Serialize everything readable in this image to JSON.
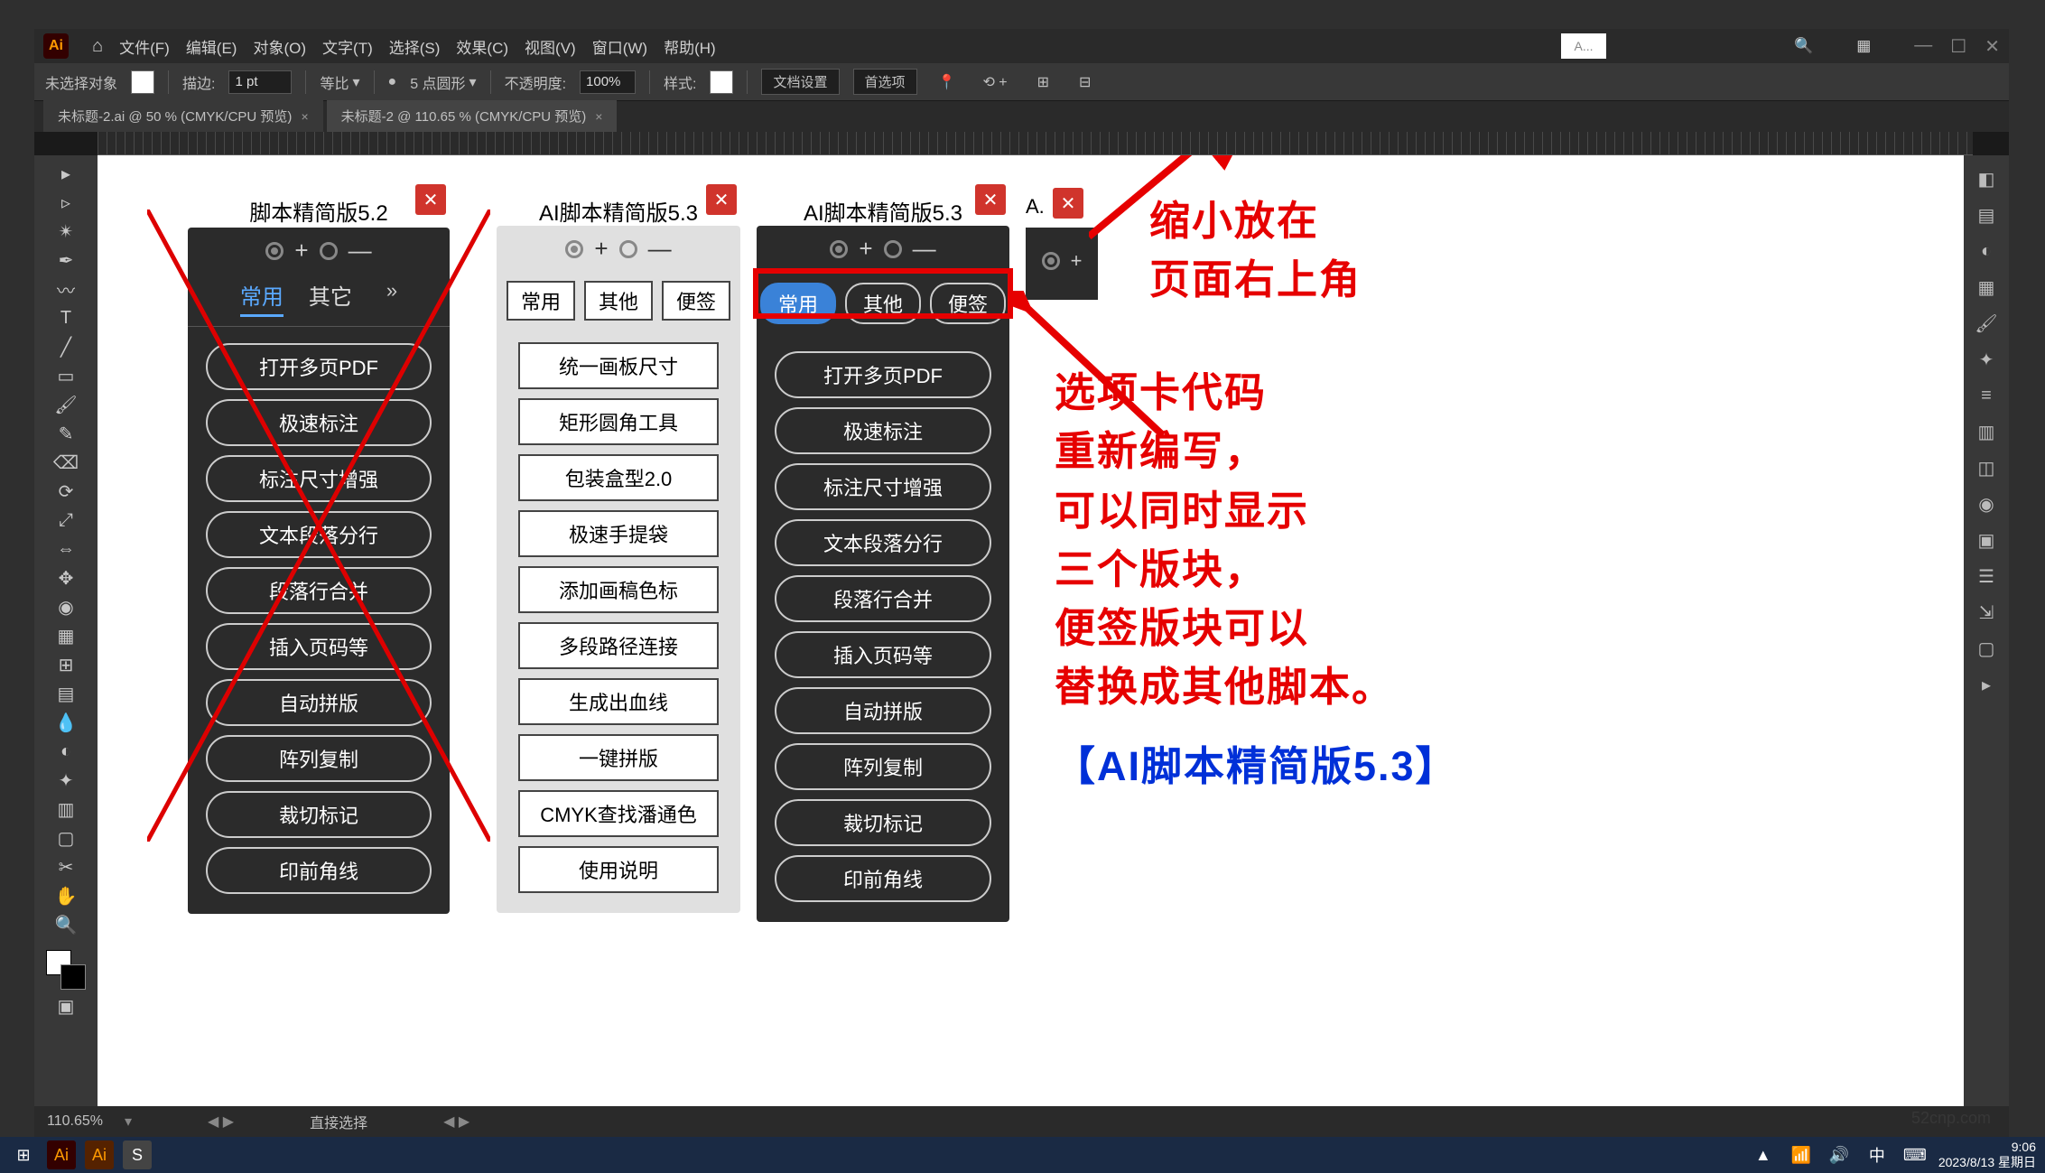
{
  "menubar": {
    "items": [
      "文件(F)",
      "编辑(E)",
      "对象(O)",
      "文字(T)",
      "选择(S)",
      "效果(C)",
      "视图(V)",
      "窗口(W)",
      "帮助(H)"
    ],
    "searchPlaceholder": "A..."
  },
  "optionbar": {
    "noSelect": "未选择对象",
    "stroke": "描边:",
    "strokeVal": "1 pt",
    "isometric": "等比",
    "pt5round": "5 点圆形",
    "opacity": "不透明度:",
    "opacityVal": "100%",
    "style": "样式:",
    "docSetup": "文档设置",
    "prefs": "首选项"
  },
  "tabs": [
    {
      "label": "未标题-2.ai @ 50 % (CMYK/CPU 预览)"
    },
    {
      "label": "未标题-2 @ 110.65 % (CMYK/CPU 预览)"
    }
  ],
  "status": {
    "zoom": "110.65%",
    "tool": "直接选择"
  },
  "panel52": {
    "title": "脚本精简版5.2",
    "tabs": [
      "常用",
      "其它"
    ],
    "buttons": [
      "打开多页PDF",
      "极速标注",
      "标注尺寸增强",
      "文本段落分行",
      "段落行合并",
      "插入页码等",
      "自动拼版",
      "阵列复制",
      "裁切标记",
      "印前角线"
    ]
  },
  "panel53light": {
    "title": "AI脚本精简版5.3",
    "tabs": [
      "常用",
      "其他",
      "便签"
    ],
    "buttons": [
      "统一画板尺寸",
      "矩形圆角工具",
      "包装盒型2.0",
      "极速手提袋",
      "添加画稿色标",
      "多段路径连接",
      "生成出血线",
      "一键拼版",
      "CMYK查找潘通色",
      "使用说明"
    ]
  },
  "panel53dark": {
    "title": "AI脚本精简版5.3",
    "tabs": [
      "常用",
      "其他",
      "便签"
    ],
    "buttons": [
      "打开多页PDF",
      "极速标注",
      "标注尺寸增强",
      "文本段落分行",
      "段落行合并",
      "插入页码等",
      "自动拼版",
      "阵列复制",
      "裁切标记",
      "印前角线"
    ]
  },
  "mini": {
    "title": "A."
  },
  "annotations": {
    "top": "缩小放在\n页面右上角",
    "mid": "选项卡代码\n重新编写，\n可以同时显示\n三个版块，\n便签版块可以\n替换成其他脚本。",
    "blue": "【AI脚本精简版5.3】"
  },
  "taskbar": {
    "time": "9:06",
    "date": "2023/8/13 星期日"
  },
  "watermark": "52cnp.com"
}
